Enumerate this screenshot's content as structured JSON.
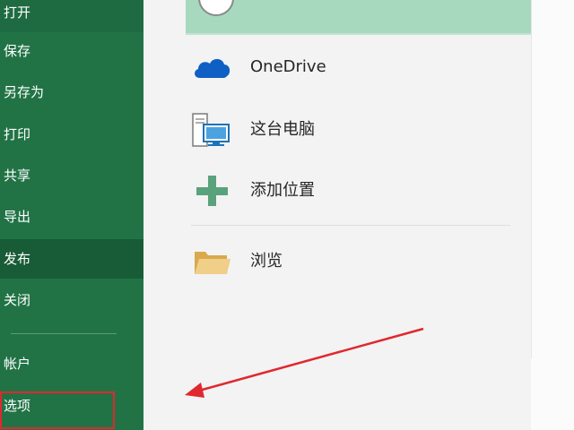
{
  "nav": {
    "items": [
      {
        "label": "打开"
      },
      {
        "label": "保存"
      },
      {
        "label": "另存为"
      },
      {
        "label": "打印"
      },
      {
        "label": "共享"
      },
      {
        "label": "导出"
      },
      {
        "label": "发布"
      },
      {
        "label": "关闭"
      },
      {
        "label": "帐户"
      },
      {
        "label": "选项"
      }
    ]
  },
  "locations": {
    "items": [
      {
        "label": "OneDrive",
        "icon": "cloud-icon"
      },
      {
        "label": "这台电脑",
        "icon": "computer-icon"
      },
      {
        "label": "添加位置",
        "icon": "plus-icon"
      },
      {
        "label": "浏览",
        "icon": "folder-icon"
      }
    ]
  },
  "colors": {
    "nav_bg": "#217346",
    "nav_active": "#185c37",
    "selected_row": "#a7d9be",
    "annotation_red": "#e0282e",
    "onedrive_blue": "#0f5fc4",
    "plus_green": "#5aa27c",
    "folder_tan": "#e8c27a"
  }
}
